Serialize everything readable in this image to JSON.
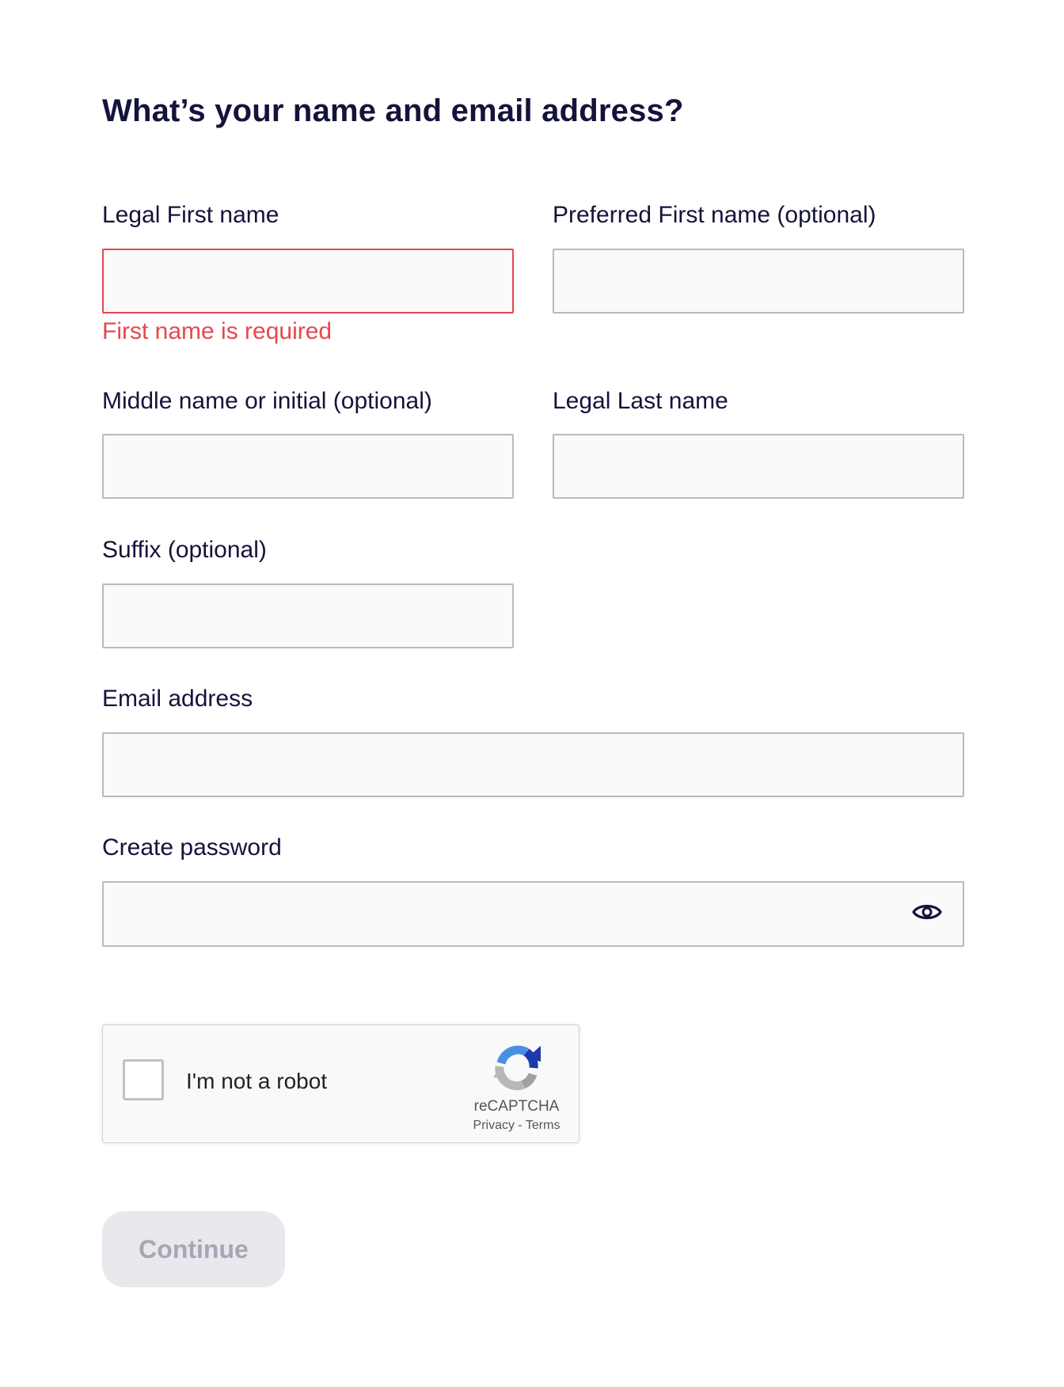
{
  "page": {
    "title": "What’s your name and email address?"
  },
  "form": {
    "legal_first_name": {
      "label": "Legal First name",
      "value": "",
      "error": "First name is required"
    },
    "preferred_first_name": {
      "label": "Preferred First name (optional)",
      "value": ""
    },
    "middle_name": {
      "label": "Middle name or initial (optional)",
      "value": ""
    },
    "legal_last_name": {
      "label": "Legal Last name",
      "value": ""
    },
    "suffix": {
      "label": "Suffix (optional)",
      "value": ""
    },
    "email": {
      "label": "Email address",
      "value": ""
    },
    "password": {
      "label": "Create password",
      "value": "",
      "toggle_icon": "eye-icon"
    }
  },
  "recaptcha": {
    "label": "I'm not a robot",
    "brand": "reCAPTCHA",
    "privacy_link": "Privacy",
    "separator": "-",
    "terms_link": "Terms",
    "checked": false
  },
  "actions": {
    "continue_label": "Continue",
    "continue_enabled": false
  },
  "colors": {
    "text": "#14133b",
    "error": "#e5484d",
    "input_border": "#b9b9c1",
    "input_background": "#fafafa",
    "button_disabled_bg": "#e8e8ed",
    "button_disabled_text": "#a7a6b5"
  }
}
